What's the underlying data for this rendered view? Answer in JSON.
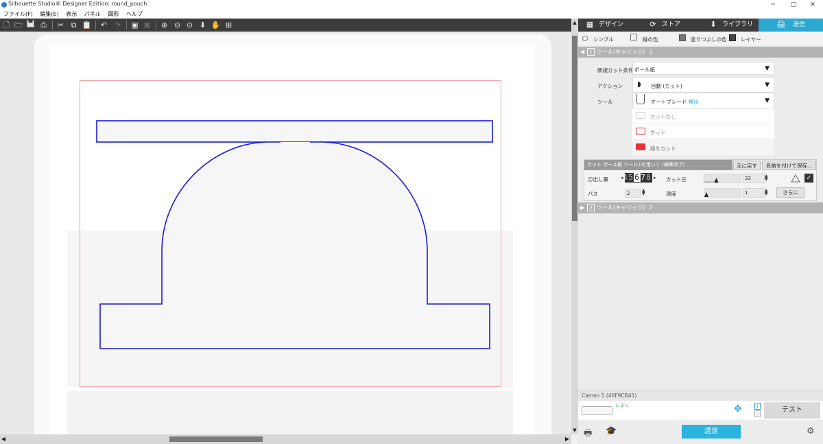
{
  "window": {
    "title": "Silhouette Studio® Designer Edition: round_pouch",
    "minimize": "─",
    "maximize": "▢",
    "close": "✕"
  },
  "menu": [
    "ファイル(F)",
    "編集(E)",
    "表示",
    "パネル",
    "図形",
    "ヘルプ"
  ],
  "toolbar_icons": [
    "new-file-icon",
    "open-folder-icon",
    "save-icon",
    "print-icon",
    "cut-icon",
    "copy-icon",
    "paste-icon",
    "undo-icon",
    "redo-icon",
    "group-icon",
    "ungroup-icon",
    "zoom-in-icon",
    "zoom-out-icon",
    "zoom-fit-icon",
    "move-down-icon",
    "pan-hand-icon",
    "fit-page-icon"
  ],
  "tabs": {
    "design": "デザイン",
    "store": "ストア",
    "library": "ライブラリ",
    "send": "送信"
  },
  "colors": {
    "active_tab": "#2ba9d1",
    "tab_bar": "#3c3c3c",
    "cut_line": "#1a1adb",
    "page_border": "#f3a0a0",
    "send_button": "#29b3de",
    "ready_text": "#2ca84a"
  },
  "modes": {
    "simple": "シンプル",
    "line_color": "線の色",
    "fill_color": "塗りつぶしの色",
    "layer": "レイヤー"
  },
  "tool1": {
    "header_num": "1",
    "header_label": "ツール(キャリッジ)",
    "header_count": "1",
    "material_label": "新規カット条件",
    "material_value": "ボール紙",
    "action_label": "アクション",
    "action_value": "自動 (カット)",
    "tool_label": "ツール",
    "tool_value": "オートブレード",
    "tool_detected": "検出",
    "options": [
      "カットなし",
      "カット",
      "線をカット"
    ]
  },
  "cut_settings": {
    "title": "カット ボール紙 ツール1を用いて",
    "edited": "(編集完了)",
    "reset": "元に戻す",
    "save_as": "名前を付けて保存...",
    "blade_label": "刃出し量",
    "blade_digits": [
      "4",
      "5",
      "6",
      "7",
      "8"
    ],
    "force_label": "カット圧",
    "force_value": "33",
    "force_level": 0.33,
    "passes_label": "パス",
    "passes_value": "2",
    "speed_label": "速度",
    "speed_value": "1",
    "speed_level": 0.0,
    "more": "さらに"
  },
  "tool2": {
    "header_num": "2",
    "header_label": "ツール(キャリッジ)",
    "header_count": "2"
  },
  "device": {
    "name": "Cameo 5 (46F9CB41)",
    "status": "レディ",
    "slot1": "1",
    "slot2": "2",
    "test": "テスト",
    "send": "送信"
  }
}
